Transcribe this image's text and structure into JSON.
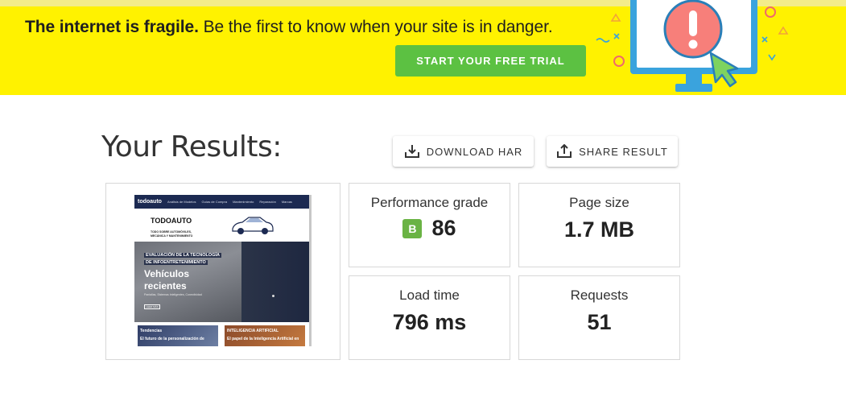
{
  "banner": {
    "headline_bold": "The internet is fragile.",
    "headline_rest": " Be the first to know when your site is in danger.",
    "cta_label": "START YOUR FREE TRIAL",
    "illustration_icon": "monitor-alert-icon",
    "bg_color": "#fff200",
    "cta_color": "#5cc142"
  },
  "results": {
    "title": "Your Results:",
    "download_label": "DOWNLOAD HAR",
    "download_icon": "download-icon",
    "share_label": "SHARE RESULT",
    "share_icon": "share-icon"
  },
  "metrics": {
    "performance": {
      "label": "Performance grade",
      "grade": "B",
      "value": "86",
      "grade_color": "#6ab344"
    },
    "page_size": {
      "label": "Page size",
      "value": "1.7 MB"
    },
    "load_time": {
      "label": "Load time",
      "value": "796 ms"
    },
    "requests": {
      "label": "Requests",
      "value": "51"
    }
  },
  "screenshot": {
    "nav_logo": "todoauto",
    "nav_items": [
      "Análisis de Modelos",
      "Guías de Compra",
      "Mantenimiento",
      "Reparación",
      "Marcas"
    ],
    "brand": "TODOAUTO",
    "tagline": "TODO SOBRE AUTOMÓVILES, MECÁNICA Y MANTENIMIENTO",
    "kicker_line1": "EVALUACIÓN DE LA TECNOLOGÍA",
    "kicker_line2": "DE INFOENTRETENIMIENTO",
    "headline_line1": "Vehículos",
    "headline_line2": "recientes",
    "sub": "Pantallas, Sistemas Inteligentes, Conectividad",
    "button": "LEER MÁS",
    "card1_label": "Tendencias",
    "card1_sub": "El futuro de la personalización de",
    "card2_label": "INTELIGENCIA ARTIFICIAL",
    "card2_sub": "El papel de la Inteligencia Artificial en"
  }
}
